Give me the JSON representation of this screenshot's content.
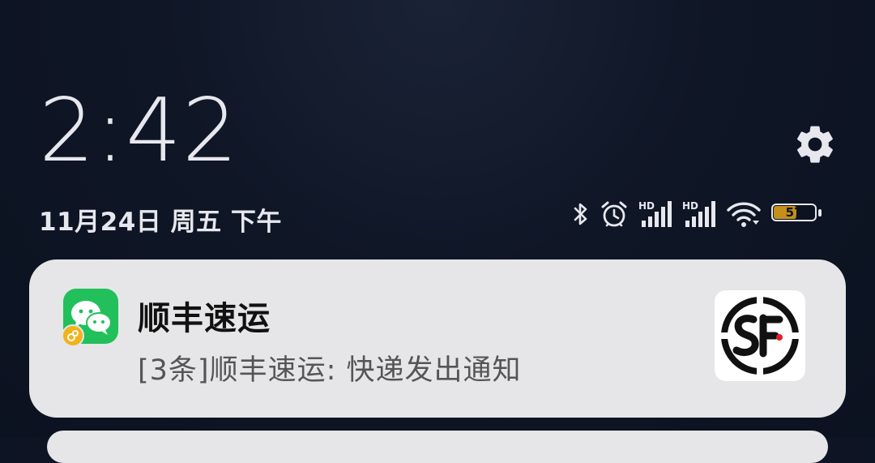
{
  "lockscreen": {
    "time": "2:42",
    "date": "11月24日 周五 下午"
  },
  "status_bar": {
    "icons": [
      "bluetooth-icon",
      "alarm-icon",
      "hd-signal-icon",
      "hd-signal-icon",
      "wifi-icon"
    ],
    "hd_label_1": "HD",
    "hd_label_2": "HD",
    "battery_level": "57",
    "battery_fraction": 0.57,
    "battery_color": "#c58f1d"
  },
  "notification": {
    "app": "wechat-icon",
    "title": "顺丰速运",
    "body": "[3条]顺丰速运: 快递发出通知",
    "thumbnail": "sf-express-logo"
  }
}
